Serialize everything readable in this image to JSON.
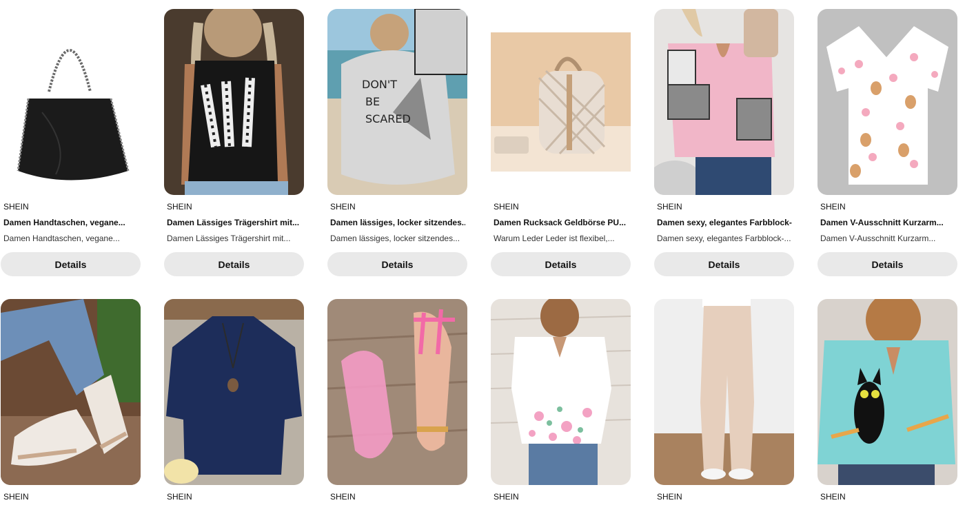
{
  "products": [
    {
      "brand": "SHEIN",
      "title": "Damen Handtaschen, vegane...",
      "description": "Damen Handtaschen, vegane...",
      "button": "Details",
      "image": "black-chain-tote-bag"
    },
    {
      "brand": "SHEIN",
      "title": "Damen Lässiges Trägershirt mit...",
      "description": "Damen Lässiges Trägershirt mit...",
      "button": "Details",
      "image": "giraffe-tank-top"
    },
    {
      "brand": "SHEIN",
      "title": "Damen lässiges, locker sitzendes...",
      "description": "Damen lässiges, locker sitzendes...",
      "button": "Details",
      "image": "dont-be-scared-sweatshirt"
    },
    {
      "brand": "SHEIN",
      "title": "Damen Rucksack Geldbörse PU...",
      "description": "Warum Leder Leder ist flexibel,...",
      "button": "Details",
      "image": "beige-backpack-purse"
    },
    {
      "brand": "SHEIN",
      "title": "Damen sexy, elegantes Farbblock-...",
      "description": "Damen sexy, elegantes Farbblock-...",
      "button": "Details",
      "image": "pink-colorblock-top"
    },
    {
      "brand": "SHEIN",
      "title": "Damen V-Ausschnitt Kurzarm...",
      "description": "Damen V-Ausschnitt Kurzarm...",
      "button": "Details",
      "image": "bunny-bow-scrub-top"
    },
    {
      "brand": "SHEIN",
      "image": "white-sneakers"
    },
    {
      "brand": "SHEIN",
      "image": "navy-linen-blouse"
    },
    {
      "brand": "SHEIN",
      "image": "pink-jelly-sandals"
    },
    {
      "brand": "SHEIN",
      "image": "floral-keyhole-blouse"
    },
    {
      "brand": "SHEIN",
      "image": "beige-flare-pants"
    },
    {
      "brand": "SHEIN",
      "image": "black-cat-print-shirt"
    }
  ],
  "colors": {
    "button_bg": "#e9e9e9",
    "text": "#111111"
  }
}
